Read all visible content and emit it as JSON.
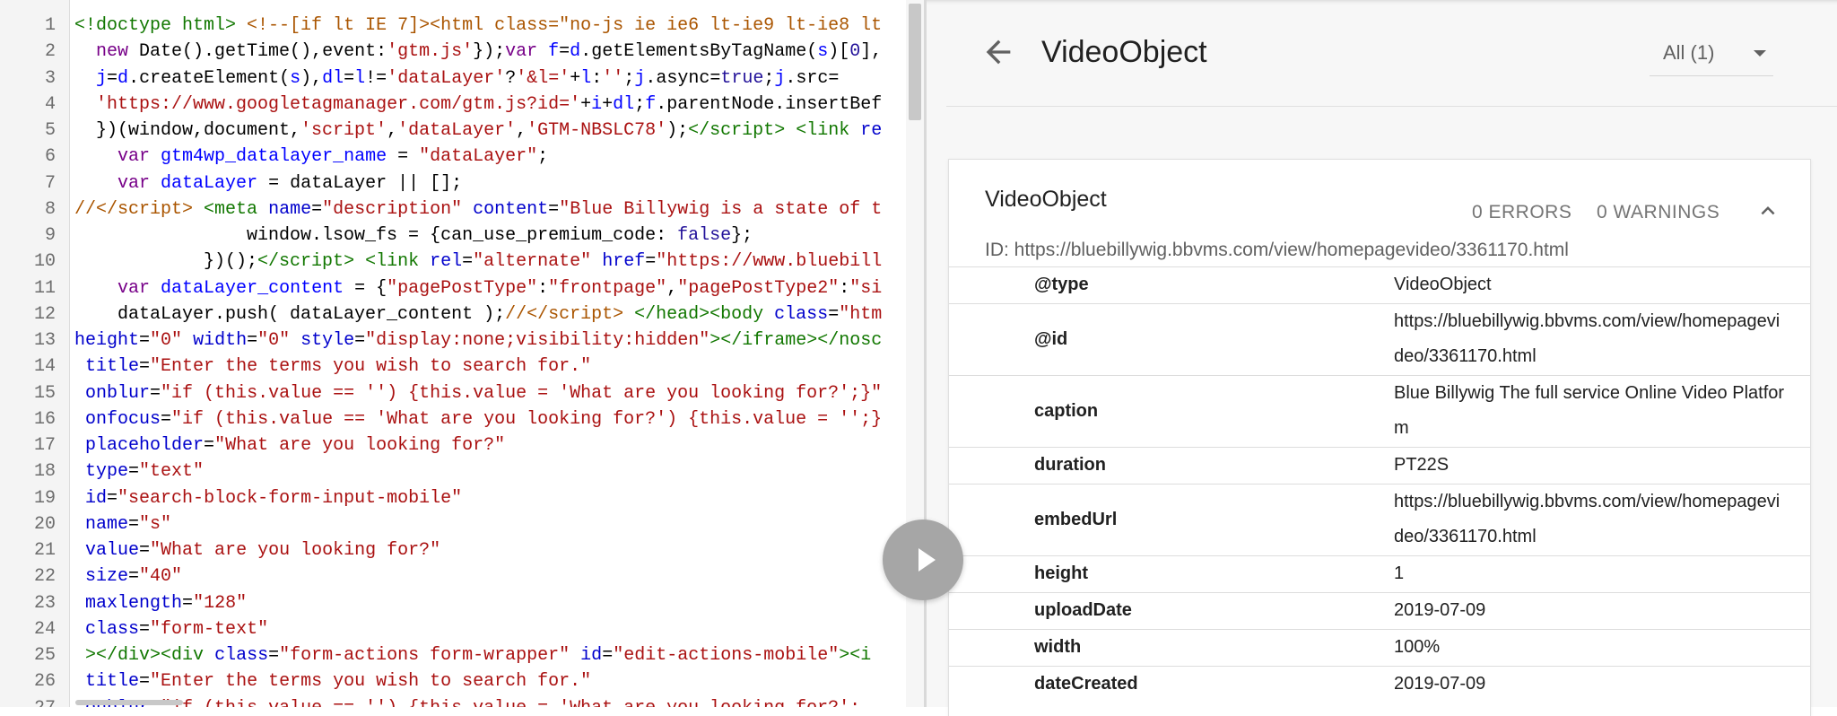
{
  "code": {
    "lines": [
      {
        "n": "1",
        "html": "<span class='c-tag'>&lt;!doctype html&gt;</span> <span class='c-com'>&lt;!--[if lt IE 7]&gt;&lt;html class=\"no-js ie ie6 lt-ie9 lt-ie8 lt</span>"
      },
      {
        "n": "2",
        "html": "  <span class='c-kw'>new</span> Date().getTime(),event:<span class='c-str'>'gtm.js'</span>});<span class='c-kw'>var</span> <span class='c-def'>f</span>=<span class='c-def'>d</span>.getElementsByTagName(<span class='c-def'>s</span>)[<span class='c-bool'>0</span>],"
      },
      {
        "n": "3",
        "html": "  <span class='c-def'>j</span>=<span class='c-def'>d</span>.createElement(<span class='c-def'>s</span>),<span class='c-def'>dl</span>=<span class='c-def'>l</span>!=<span class='c-str'>'dataLayer'</span>?<span class='c-str'>'&amp;l='</span>+<span class='c-def'>l</span>:<span class='c-str'>''</span>;<span class='c-def'>j</span>.async=<span class='c-bool'>true</span>;<span class='c-def'>j</span>.src="
      },
      {
        "n": "4",
        "html": "  <span class='c-str'>'https://www.googletagmanager.com/gtm.js?id='</span>+<span class='c-def'>i</span>+<span class='c-def'>dl</span>;<span class='c-def'>f</span>.parentNode.insertBef"
      },
      {
        "n": "5",
        "html": "  })(window,document,<span class='c-str'>'script'</span>,<span class='c-str'>'dataLayer'</span>,<span class='c-str'>'GTM-NBSLC78'</span>);<span class='c-tag'>&lt;/script&gt;</span> <span class='c-tag'>&lt;link</span> <span class='c-att'>re</span>"
      },
      {
        "n": "6",
        "html": "    <span class='c-kw'>var</span> <span class='c-def'>gtm4wp_datalayer_name</span> = <span class='c-str'>\"dataLayer\"</span>;"
      },
      {
        "n": "7",
        "html": "    <span class='c-kw'>var</span> <span class='c-def'>dataLayer</span> = dataLayer || [];"
      },
      {
        "n": "8",
        "html": "<span class='c-com'>//&lt;/script&gt;</span> <span class='c-tag'>&lt;meta</span> <span class='c-att'>name</span>=<span class='c-str'>\"description\"</span> <span class='c-att'>content</span>=<span class='c-str'>\"Blue Billywig is a state of t</span>"
      },
      {
        "n": "9",
        "html": "                window.lsow_fs = {can_use_premium_code: <span class='c-bool'>false</span>};"
      },
      {
        "n": "10",
        "html": "            })();<span class='c-tag'>&lt;/script&gt;</span> <span class='c-tag'>&lt;link</span> <span class='c-att'>rel</span>=<span class='c-str'>\"alternate\"</span> <span class='c-att'>href</span>=<span class='c-str'>\"https://www.bluebill</span>"
      },
      {
        "n": "11",
        "html": "    <span class='c-kw'>var</span> <span class='c-def'>dataLayer_content</span> = {<span class='c-str'>\"pagePostType\"</span>:<span class='c-str'>\"frontpage\"</span>,<span class='c-str'>\"pagePostType2\"</span>:<span class='c-str'>\"si</span>"
      },
      {
        "n": "12",
        "html": "    dataLayer.push( dataLayer_content );<span class='c-com'>//&lt;/script&gt;</span> <span class='c-tag'>&lt;/head&gt;&lt;body</span> <span class='c-att'>class</span>=<span class='c-str'>\"htm</span>"
      },
      {
        "n": "13",
        "html": "<span class='c-att'>height</span>=<span class='c-str'>\"0\"</span> <span class='c-att'>width</span>=<span class='c-str'>\"0\"</span> <span class='c-att'>style</span>=<span class='c-str'>\"display:none;visibility:hidden\"</span><span class='c-tag'>&gt;&lt;/iframe&gt;&lt;/nosc</span>"
      },
      {
        "n": "14",
        "html": " <span class='c-att'>title</span>=<span class='c-str'>\"Enter the terms you wish to search for.\"</span>"
      },
      {
        "n": "15",
        "html": " <span class='c-att'>onblur</span>=<span class='c-str'>\"if (this.value == '') {this.value = 'What are you looking for?';}\"</span>"
      },
      {
        "n": "16",
        "html": " <span class='c-att'>onfocus</span>=<span class='c-str'>\"if (this.value == 'What are you looking for?') {this.value = '';}</span>"
      },
      {
        "n": "17",
        "html": " <span class='c-att'>placeholder</span>=<span class='c-str'>\"What are you looking for?\"</span>"
      },
      {
        "n": "18",
        "html": " <span class='c-att'>type</span>=<span class='c-str'>\"text\"</span>"
      },
      {
        "n": "19",
        "html": " <span class='c-att'>id</span>=<span class='c-str'>\"search-block-form-input-mobile\"</span>"
      },
      {
        "n": "20",
        "html": " <span class='c-att'>name</span>=<span class='c-str'>\"s\"</span>"
      },
      {
        "n": "21",
        "html": " <span class='c-att'>value</span>=<span class='c-str'>\"What are you looking for?\"</span>"
      },
      {
        "n": "22",
        "html": " <span class='c-att'>size</span>=<span class='c-str'>\"40\"</span>"
      },
      {
        "n": "23",
        "html": " <span class='c-att'>maxlength</span>=<span class='c-str'>\"128\"</span>"
      },
      {
        "n": "24",
        "html": " <span class='c-att'>class</span>=<span class='c-str'>\"form-text\"</span>"
      },
      {
        "n": "25",
        "html": " <span class='c-tag'>&gt;&lt;/div&gt;&lt;div</span> <span class='c-att'>class</span>=<span class='c-str'>\"form-actions form-wrapper\"</span> <span class='c-att'>id</span>=<span class='c-str'>\"edit-actions-mobile\"</span><span class='c-tag'>&gt;&lt;i</span>"
      },
      {
        "n": "26",
        "html": " <span class='c-att'>title</span>=<span class='c-str'>\"Enter the terms you wish to search for.\"</span>"
      },
      {
        "n": "27",
        "html": " <span class='c-att'>onblur</span>=<span class='c-str'>\"if (this.value == '') {this.value = 'What are you looking for?';</span>"
      }
    ]
  },
  "results": {
    "header": {
      "title": "VideoObject",
      "filter": "All (1)"
    },
    "card": {
      "title": "VideoObject",
      "errors": "0 ERRORS",
      "warnings": "0 WARNINGS",
      "id_line": "ID: https://bluebillywig.bbvms.com/view/homepagevideo/3361170.html",
      "properties": [
        {
          "key": "@type",
          "value": "VideoObject",
          "lines": 1
        },
        {
          "key": "@id",
          "value": "https://bluebillywig.bbvms.com/view/homepagevideo/3361170.html",
          "lines": 2
        },
        {
          "key": "caption",
          "value": "Blue Billywig The full service Online Video Platform",
          "lines": 2
        },
        {
          "key": "duration",
          "value": "PT22S",
          "lines": 1
        },
        {
          "key": "embedUrl",
          "value": "https://bluebillywig.bbvms.com/view/homepagevideo/3361170.html",
          "lines": 2
        },
        {
          "key": "height",
          "value": "1",
          "lines": 1
        },
        {
          "key": "uploadDate",
          "value": "2019-07-09",
          "lines": 1
        },
        {
          "key": "width",
          "value": "100%",
          "lines": 1
        },
        {
          "key": "dateCreated",
          "value": "2019-07-09",
          "lines": 1
        }
      ]
    }
  }
}
